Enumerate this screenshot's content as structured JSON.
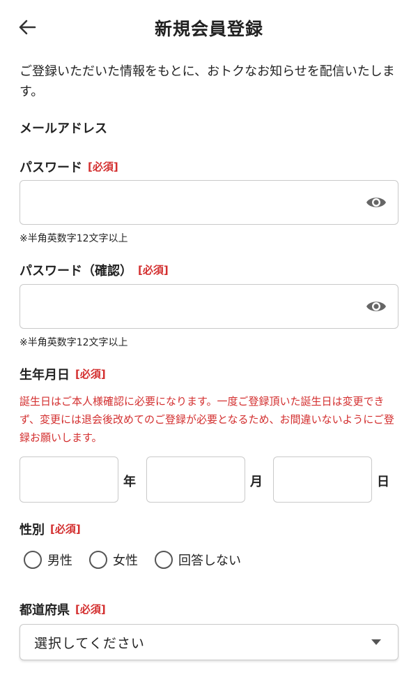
{
  "header": {
    "title": "新規会員登録",
    "back_icon": "arrow-left-icon"
  },
  "intro": "ご登録いただいた情報をもとに、おトクなお知らせを配信いたします。",
  "required_label": "[必須]",
  "email": {
    "label": "メールアドレス"
  },
  "password": {
    "label": "パスワード",
    "value": "",
    "hint": "※半角英数字12文字以上",
    "toggle_icon": "eye-icon"
  },
  "password_confirm": {
    "label": "パスワード（確認）",
    "value": "",
    "hint": "※半角英数字12文字以上",
    "toggle_icon": "eye-icon"
  },
  "birthday": {
    "label": "生年月日",
    "notice": "誕生日はご本人様確認に必要になります。一度ご登録頂いた誕生日は変更できず、変更には退会後改めてのご登録が必要となるため、お間違いないようにご登録お願いします。",
    "year_unit": "年",
    "month_unit": "月",
    "day_unit": "日",
    "year": "",
    "month": "",
    "day": ""
  },
  "gender": {
    "label": "性別",
    "options": [
      "男性",
      "女性",
      "回答しない"
    ]
  },
  "prefecture": {
    "label": "都道府県",
    "selected": "選択してください"
  },
  "colors": {
    "required": "#d32f2f",
    "border": "#c9c9c9",
    "text": "#222222"
  }
}
